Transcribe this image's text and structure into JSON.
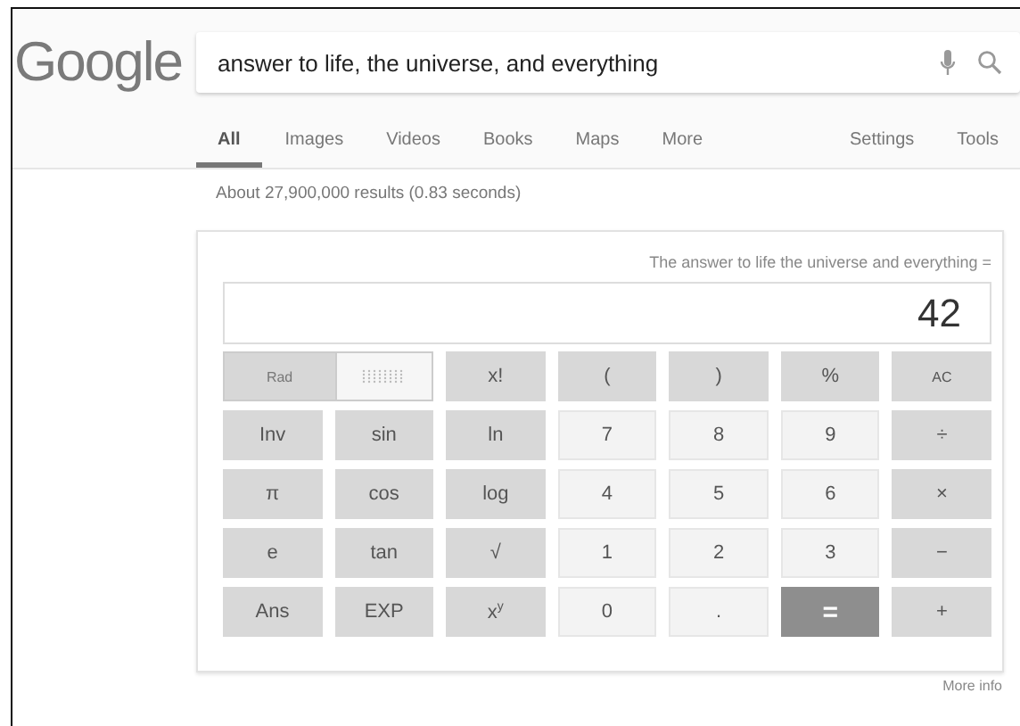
{
  "logo": "Google",
  "search": {
    "value": "answer to life, the universe, and everything"
  },
  "tabs": [
    {
      "label": "All",
      "selected": true
    },
    {
      "label": "Images",
      "selected": false
    },
    {
      "label": "Videos",
      "selected": false
    },
    {
      "label": "Books",
      "selected": false
    },
    {
      "label": "Maps",
      "selected": false
    },
    {
      "label": "More",
      "selected": false
    }
  ],
  "tools": [
    "Settings",
    "Tools"
  ],
  "result_stats": "About 27,900,000 results (0.83 seconds)",
  "calculator": {
    "expression": "The answer to life the universe and everything =",
    "display": "42",
    "rows": [
      [
        {
          "kind": "mode",
          "label": "Rad",
          "selected": true
        },
        {
          "kind": "mode_dots",
          "selected": false
        },
        {
          "label": "x!",
          "kind": "fn"
        },
        {
          "label": "(",
          "kind": "fn"
        },
        {
          "label": ")",
          "kind": "fn"
        },
        {
          "label": "%",
          "kind": "fn"
        },
        {
          "label": "AC",
          "kind": "small"
        }
      ],
      [
        {
          "label": "Inv",
          "kind": "fn"
        },
        {
          "label": "sin",
          "kind": "fn"
        },
        {
          "label": "ln",
          "kind": "fn"
        },
        {
          "label": "7",
          "kind": "num"
        },
        {
          "label": "8",
          "kind": "num"
        },
        {
          "label": "9",
          "kind": "num"
        },
        {
          "label": "÷",
          "kind": "fn"
        }
      ],
      [
        {
          "label": "π",
          "kind": "fn"
        },
        {
          "label": "cos",
          "kind": "fn"
        },
        {
          "label": "log",
          "kind": "fn"
        },
        {
          "label": "4",
          "kind": "num"
        },
        {
          "label": "5",
          "kind": "num"
        },
        {
          "label": "6",
          "kind": "num"
        },
        {
          "label": "×",
          "kind": "fn"
        }
      ],
      [
        {
          "label": "e",
          "kind": "fn"
        },
        {
          "label": "tan",
          "kind": "fn"
        },
        {
          "label": "√",
          "kind": "fn"
        },
        {
          "label": "1",
          "kind": "num"
        },
        {
          "label": "2",
          "kind": "num"
        },
        {
          "label": "3",
          "kind": "num"
        },
        {
          "label": "−",
          "kind": "fn"
        }
      ],
      [
        {
          "label": "Ans",
          "kind": "fn"
        },
        {
          "label": "EXP",
          "kind": "fn"
        },
        {
          "label": "x$^{y}$",
          "kind": "fn"
        },
        {
          "label": "0",
          "kind": "num"
        },
        {
          "label": ".",
          "kind": "num"
        },
        {
          "label": "=",
          "kind": "equals"
        },
        {
          "label": "+",
          "kind": "fn"
        }
      ]
    ]
  },
  "more_info": "More info"
}
